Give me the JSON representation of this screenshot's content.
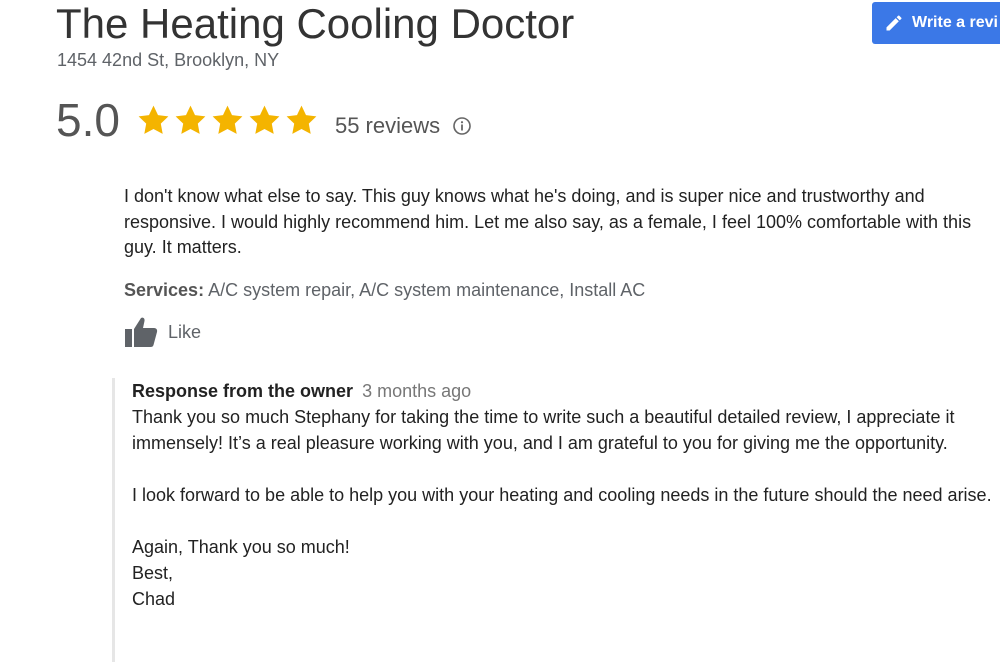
{
  "business": {
    "name": "The Heating Cooling Doctor",
    "address": "1454 42nd St, Brooklyn, NY"
  },
  "write_review_button": {
    "label": "Write a revi"
  },
  "rating": {
    "value": "5.0",
    "stars": 5,
    "reviews_label": "55 reviews"
  },
  "review": {
    "text": "I don't know what else to say. This guy knows what he's doing, and is super nice and trustworthy and responsive. I would highly recommend him.  Let me also say, as a female, I feel 100% comfortable with this guy. It matters.",
    "services_label": "Services:",
    "services_value": "A/C system repair, A/C system maintenance, Install AC",
    "like_label": "Like"
  },
  "owner_response": {
    "title": "Response from the owner",
    "time": "3 months ago",
    "paragraphs": [
      "Thank you so much Stephany for taking the time to write such a beautiful detailed review, I appreciate it immensely! It’s a real pleasure working with you, and I am grateful to you for giving me the opportunity.",
      "I look forward to be able to help you with your heating and cooling needs in the future should the need arise.",
      "Again, Thank you so much!\nBest,\nChad"
    ]
  },
  "colors": {
    "button_blue": "#3b78e7",
    "star_gold": "#f4b400",
    "text_gray": "#5f6368"
  },
  "icons": [
    "pencil-icon",
    "star-icon",
    "info-icon",
    "thumbs-up-icon"
  ]
}
